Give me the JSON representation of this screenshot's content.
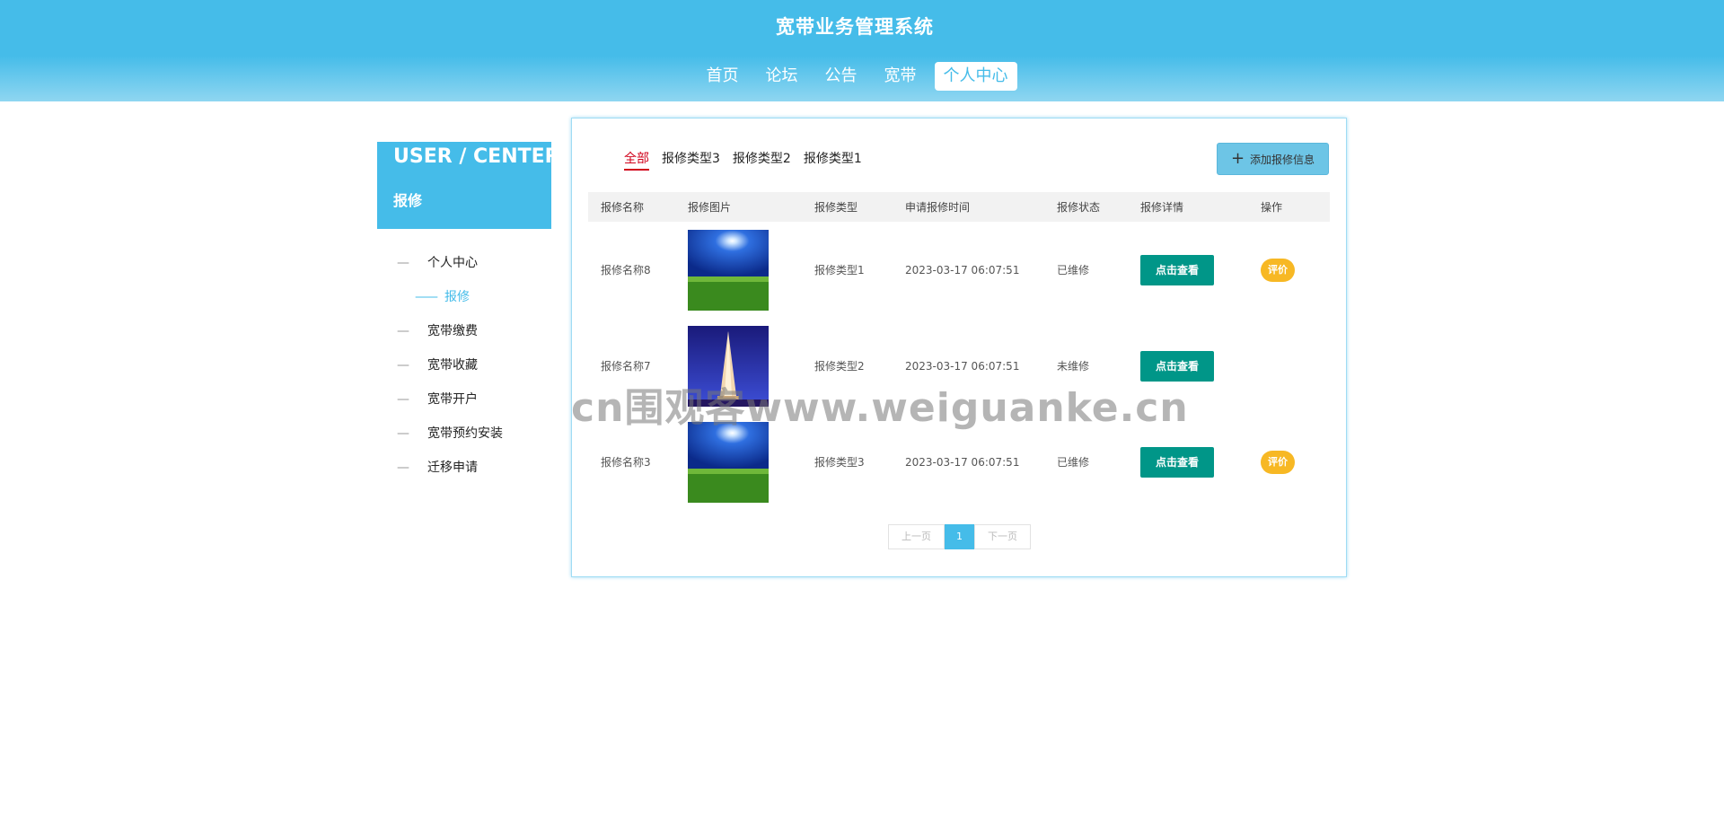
{
  "header": {
    "title": "宽带业务管理系统",
    "nav": [
      "首页",
      "论坛",
      "公告",
      "宽带",
      "个人中心"
    ]
  },
  "sidebar": {
    "title_en": "USER / CENTER",
    "title_cn": "报修",
    "items": [
      {
        "dash": "—",
        "label": "个人中心"
      },
      {
        "dash": "——",
        "label": "报修"
      },
      {
        "dash": "—",
        "label": "宽带缴费"
      },
      {
        "dash": "—",
        "label": "宽带收藏"
      },
      {
        "dash": "—",
        "label": "宽带开户"
      },
      {
        "dash": "—",
        "label": "宽带预约安装"
      },
      {
        "dash": "—",
        "label": "迁移申请"
      }
    ]
  },
  "main": {
    "tabs": [
      "全部",
      "报修类型3",
      "报修类型2",
      "报修类型1"
    ],
    "add_button": "添加报修信息",
    "columns": [
      "报修名称",
      "报修图片",
      "报修类型",
      "申请报修时间",
      "报修状态",
      "报修详情",
      "操作"
    ],
    "rows": [
      {
        "name": "报修名称8",
        "image": "moon-field",
        "type": "报修类型1",
        "time": "2023-03-17 06:07:51",
        "status": "已维修",
        "detail": "点击查看",
        "action": "评价"
      },
      {
        "name": "报修名称7",
        "image": "eiffel-tower",
        "type": "报修类型2",
        "time": "2023-03-17 06:07:51",
        "status": "未维修",
        "detail": "点击查看",
        "action": ""
      },
      {
        "name": "报修名称3",
        "image": "moon-field",
        "type": "报修类型3",
        "time": "2023-03-17 06:07:51",
        "status": "已维修",
        "detail": "点击查看",
        "action": "评价"
      }
    ],
    "pager": {
      "prev": "上一页",
      "current": "1",
      "next": "下一页"
    }
  },
  "watermark": "cn围观客www.weiguanke.cn",
  "colors": {
    "accent": "#45bce9",
    "view_button": "#009688",
    "rate_button": "#f7b824",
    "active_tab": "#d0021b"
  }
}
